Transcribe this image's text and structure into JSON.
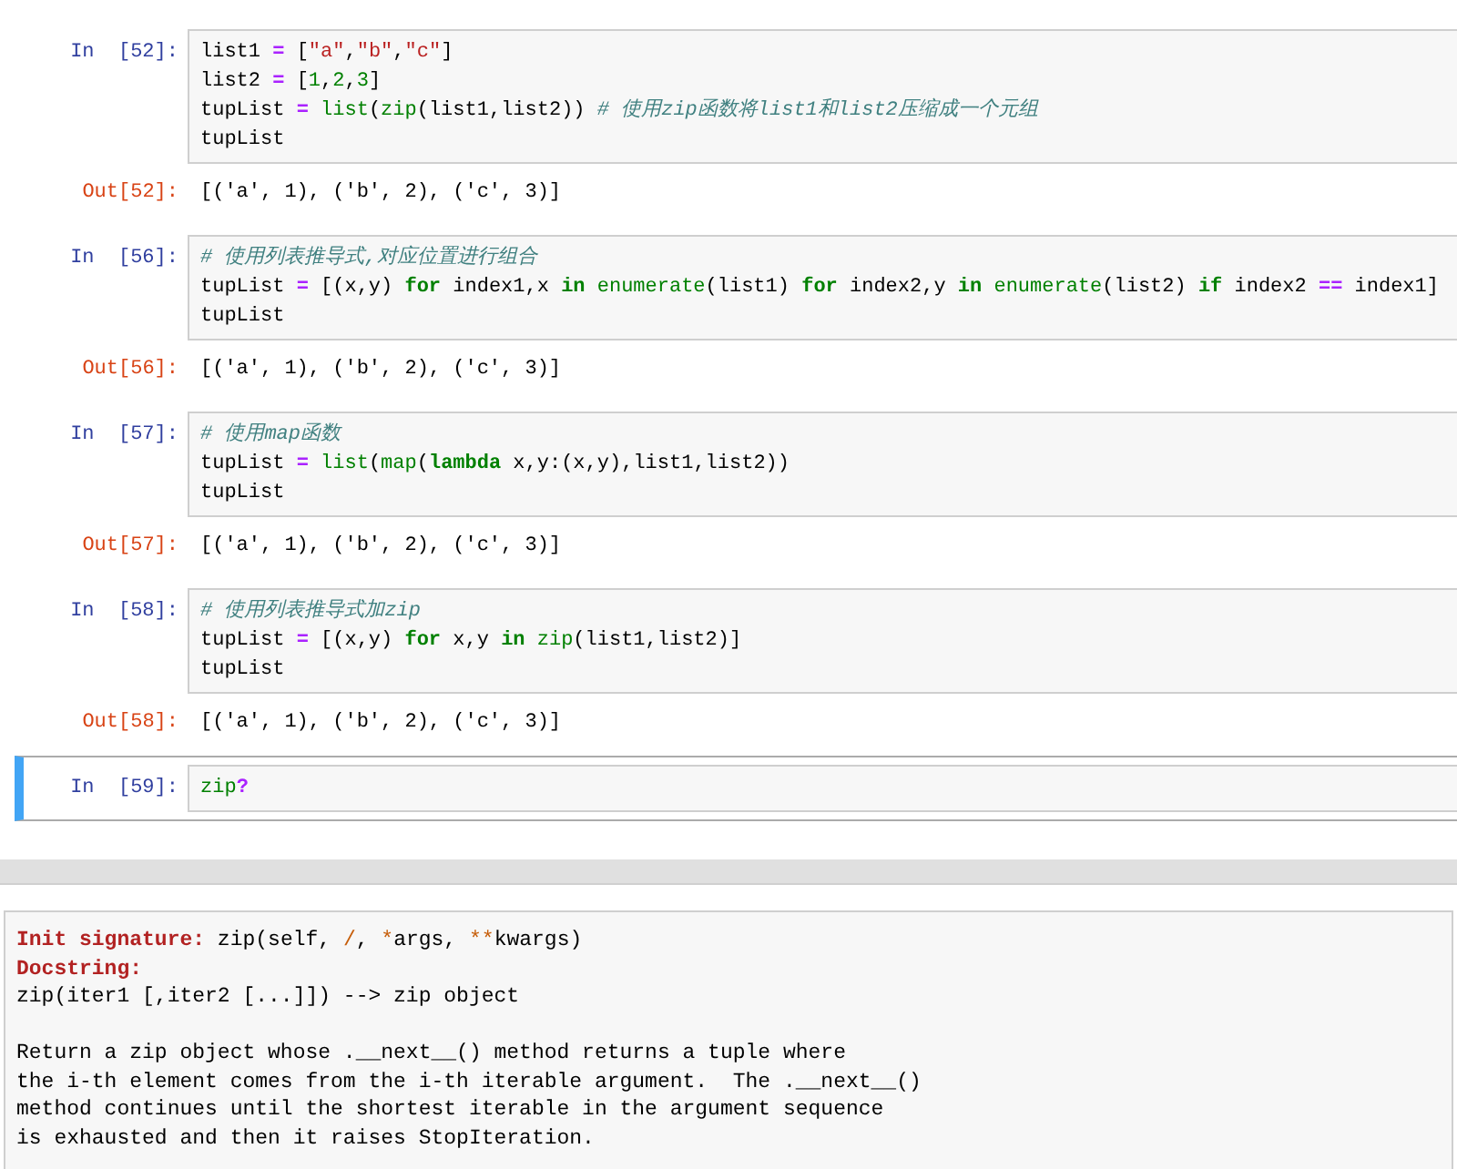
{
  "cells": [
    {
      "prompt": "In  [52]:",
      "selected": false,
      "lines": [
        [
          {
            "text": "list1 ",
            "kind": "name"
          },
          {
            "text": "=",
            "kind": "op"
          },
          {
            "text": " [",
            "kind": "name"
          },
          {
            "text": "\"a\"",
            "kind": "str"
          },
          {
            "text": ",",
            "kind": "name"
          },
          {
            "text": "\"b\"",
            "kind": "str"
          },
          {
            "text": ",",
            "kind": "name"
          },
          {
            "text": "\"c\"",
            "kind": "str"
          },
          {
            "text": "]",
            "kind": "name"
          }
        ],
        [
          {
            "text": "list2 ",
            "kind": "name"
          },
          {
            "text": "=",
            "kind": "op"
          },
          {
            "text": " [",
            "kind": "name"
          },
          {
            "text": "1",
            "kind": "num"
          },
          {
            "text": ",",
            "kind": "name"
          },
          {
            "text": "2",
            "kind": "num"
          },
          {
            "text": ",",
            "kind": "name"
          },
          {
            "text": "3",
            "kind": "num"
          },
          {
            "text": "]",
            "kind": "name"
          }
        ],
        [
          {
            "text": "tupList ",
            "kind": "name"
          },
          {
            "text": "=",
            "kind": "op"
          },
          {
            "text": " list",
            "kind": "builtin"
          },
          {
            "text": "(",
            "kind": "name"
          },
          {
            "text": "zip",
            "kind": "builtin"
          },
          {
            "text": "(list1,list2)) ",
            "kind": "name"
          },
          {
            "text": "# 使用zip函数将list1和list2压缩成一个元组",
            "kind": "comment"
          }
        ],
        [
          {
            "text": "tupList",
            "kind": "name"
          }
        ]
      ],
      "output": {
        "prompt": "Out[52]:",
        "text": "[('a', 1), ('b', 2), ('c', 3)]"
      }
    },
    {
      "prompt": "In  [56]:",
      "selected": false,
      "lines": [
        [
          {
            "text": "# 使用列表推导式,对应位置进行组合",
            "kind": "comment"
          }
        ],
        [
          {
            "text": "tupList ",
            "kind": "name"
          },
          {
            "text": "=",
            "kind": "op"
          },
          {
            "text": " [(x,y) ",
            "kind": "name"
          },
          {
            "text": "for",
            "kind": "keyword"
          },
          {
            "text": " index1,x ",
            "kind": "name"
          },
          {
            "text": "in",
            "kind": "keyword"
          },
          {
            "text": " enumerate",
            "kind": "builtin"
          },
          {
            "text": "(list1) ",
            "kind": "name"
          },
          {
            "text": "for",
            "kind": "keyword"
          },
          {
            "text": " index2,y ",
            "kind": "name"
          },
          {
            "text": "in",
            "kind": "keyword"
          },
          {
            "text": " enumerate",
            "kind": "builtin"
          },
          {
            "text": "(list2) ",
            "kind": "name"
          },
          {
            "text": "if",
            "kind": "keyword"
          },
          {
            "text": " index2 ",
            "kind": "name"
          },
          {
            "text": "==",
            "kind": "op"
          },
          {
            "text": " index1]",
            "kind": "name"
          }
        ],
        [
          {
            "text": "tupList",
            "kind": "name"
          }
        ]
      ],
      "output": {
        "prompt": "Out[56]:",
        "text": "[('a', 1), ('b', 2), ('c', 3)]"
      }
    },
    {
      "prompt": "In  [57]:",
      "selected": false,
      "lines": [
        [
          {
            "text": "# 使用map函数",
            "kind": "comment"
          }
        ],
        [
          {
            "text": "tupList ",
            "kind": "name"
          },
          {
            "text": "=",
            "kind": "op"
          },
          {
            "text": " list",
            "kind": "builtin"
          },
          {
            "text": "(",
            "kind": "name"
          },
          {
            "text": "map",
            "kind": "builtin"
          },
          {
            "text": "(",
            "kind": "name"
          },
          {
            "text": "lambda",
            "kind": "keyword"
          },
          {
            "text": " x,y:(x,y),list1,list2))",
            "kind": "name"
          }
        ],
        [
          {
            "text": "tupList",
            "kind": "name"
          }
        ]
      ],
      "output": {
        "prompt": "Out[57]:",
        "text": "[('a', 1), ('b', 2), ('c', 3)]"
      }
    },
    {
      "prompt": "In  [58]:",
      "selected": false,
      "lines": [
        [
          {
            "text": "# 使用列表推导式加zip",
            "kind": "comment"
          }
        ],
        [
          {
            "text": "tupList ",
            "kind": "name"
          },
          {
            "text": "=",
            "kind": "op"
          },
          {
            "text": " [(x,y) ",
            "kind": "name"
          },
          {
            "text": "for",
            "kind": "keyword"
          },
          {
            "text": " x,y ",
            "kind": "name"
          },
          {
            "text": "in",
            "kind": "keyword"
          },
          {
            "text": " zip",
            "kind": "builtin"
          },
          {
            "text": "(list1,list2)]",
            "kind": "name"
          }
        ],
        [
          {
            "text": "tupList",
            "kind": "name"
          }
        ]
      ],
      "output": {
        "prompt": "Out[58]:",
        "text": "[('a', 1), ('b', 2), ('c', 3)]"
      }
    },
    {
      "prompt": "In  [59]:",
      "selected": true,
      "lines": [
        [
          {
            "text": "zip",
            "kind": "builtin"
          },
          {
            "text": "?",
            "kind": "op"
          }
        ]
      ]
    }
  ],
  "pager": {
    "header_lines": [
      [
        {
          "text": "Init signature:",
          "kind": "heading"
        },
        {
          "text": " zip(self, ",
          "kind": "name"
        },
        {
          "text": "/",
          "kind": "punct"
        },
        {
          "text": ", ",
          "kind": "name"
        },
        {
          "text": "*",
          "kind": "punct"
        },
        {
          "text": "args, ",
          "kind": "name"
        },
        {
          "text": "**",
          "kind": "punct"
        },
        {
          "text": "kwargs)",
          "kind": "name"
        }
      ],
      [
        {
          "text": "Docstring:",
          "kind": "heading"
        }
      ],
      [
        {
          "text": "zip(iter1 [,iter2 [...]]) --> zip object",
          "kind": "name"
        }
      ]
    ],
    "body_lines": [
      "Return a zip object whose .__next__() method returns a tuple where",
      "the i-th element comes from the i-th iterable argument.  The .__next__()",
      "method continues until the shortest iterable in the argument sequence",
      "is exhausted and then it raises StopIteration."
    ]
  }
}
